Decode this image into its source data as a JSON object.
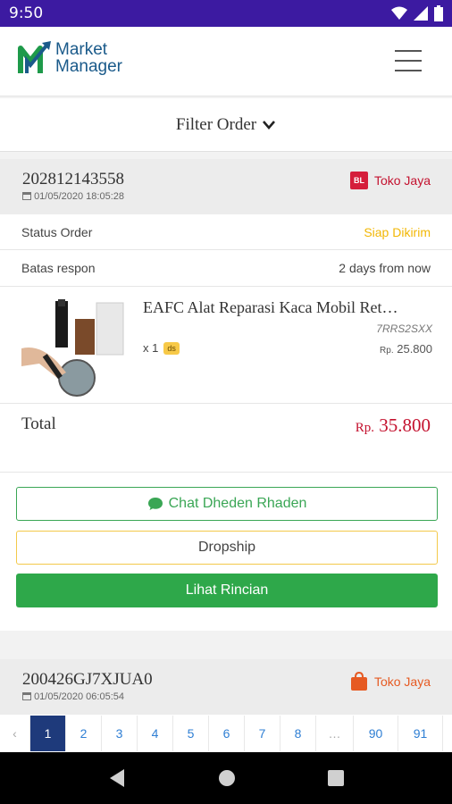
{
  "status_bar": {
    "time": "9:50"
  },
  "app": {
    "logo_line1": "Market",
    "logo_line2": "Manager"
  },
  "filter": {
    "label": "Filter Order"
  },
  "orders": [
    {
      "id": "202812143558",
      "date": "01/05/2020 18:05:28",
      "store_badge": "BL",
      "store": "Toko Jaya",
      "status_label": "Status Order",
      "status_value": "Siap Dikirim",
      "batas_label": "Batas respon",
      "batas_value": "2 days from now",
      "product": {
        "name": "EAFC Alat Reparasi Kaca Mobil Ret…",
        "sku": "7RRS2SXX",
        "qty": "x 1",
        "tag": "ds",
        "price_cur": "Rp.",
        "price": "25.800"
      },
      "total_label": "Total",
      "total_cur": "Rp.",
      "total": "35.800",
      "chat_label": "Chat Dheden Rhaden",
      "dropship_label": "Dropship",
      "lihat_label": "Lihat Rincian"
    },
    {
      "id": "200426GJ7XJUA0",
      "date": "01/05/2020 06:05:54",
      "store_badge": "S",
      "store": "Toko Jaya"
    }
  ],
  "pagination": {
    "prev": "‹",
    "pages": [
      "1",
      "2",
      "3",
      "4",
      "5",
      "6",
      "7",
      "8",
      "…",
      "90",
      "91"
    ],
    "active": "1"
  },
  "colors": {
    "status_bar": "#3c1aa1",
    "accent_red": "#c4122f",
    "green": "#2ea84a",
    "yellow": "#f2b705",
    "active_page": "#1e3a7b"
  }
}
